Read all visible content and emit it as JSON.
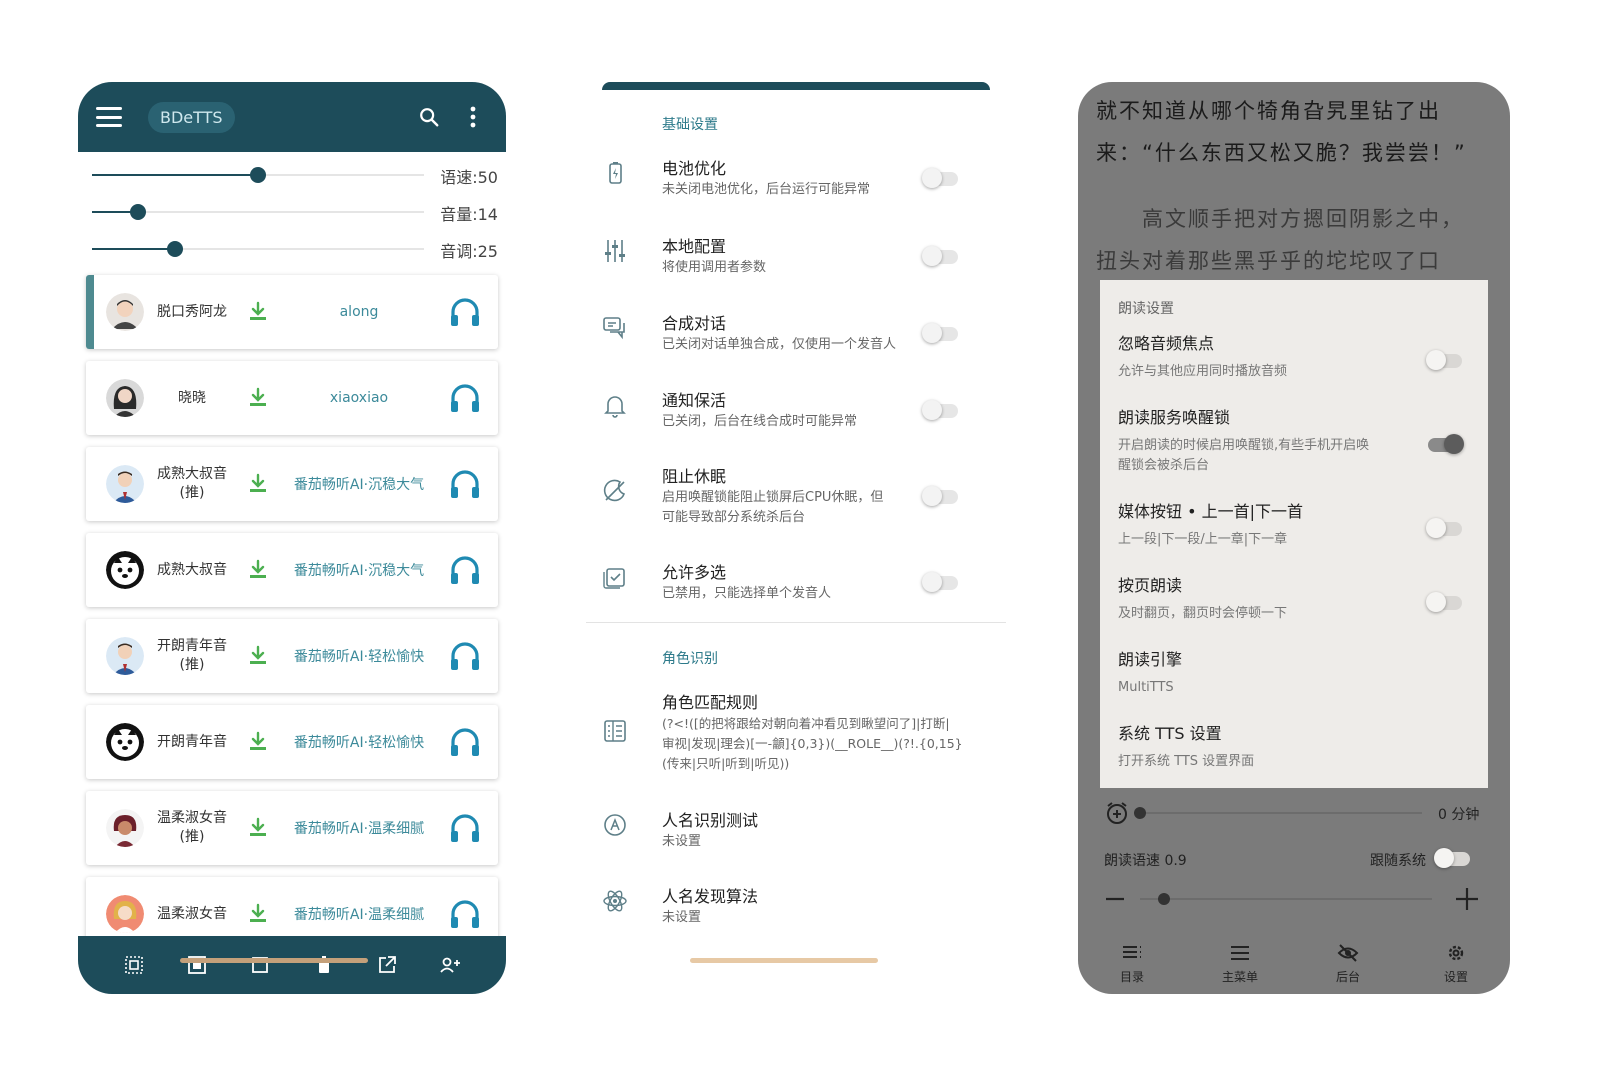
{
  "phone1": {
    "title": "BDeTTS",
    "sliders": [
      {
        "label": "语速:50",
        "value": 50
      },
      {
        "label": "音量:14",
        "value": 14
      },
      {
        "label": "音调:25",
        "value": 25
      }
    ],
    "voices": [
      {
        "name": "脱口秀阿龙",
        "desc": "along"
      },
      {
        "name": "晓晓",
        "desc": "xiaoxiao"
      },
      {
        "name": "成熟大叔音\n(推)",
        "desc": "番茄畅听AI·沉稳大气"
      },
      {
        "name": "成熟大叔音",
        "desc": "番茄畅听AI·沉稳大气"
      },
      {
        "name": "开朗青年音\n(推)",
        "desc": "番茄畅听AI·轻松愉快"
      },
      {
        "name": "开朗青年音",
        "desc": "番茄畅听AI·轻松愉快"
      },
      {
        "name": "温柔淑女音\n(推)",
        "desc": "番茄畅听AI·温柔细腻"
      },
      {
        "name": "温柔淑女音",
        "desc": "番茄畅听AI·温柔细腻"
      }
    ],
    "colors": {
      "primary": "#1d4c5a",
      "accent": "#3c8a9a",
      "download": "#4caf50"
    }
  },
  "phone2": {
    "section_basic": "基础设置",
    "settings": [
      {
        "title": "电池优化",
        "sub": "未关闭电池优化，后台运行可能异常"
      },
      {
        "title": "本地配置",
        "sub": "将使用调用者参数"
      },
      {
        "title": "合成对话",
        "sub": "已关闭对话单独合成，仅使用一个发音人"
      },
      {
        "title": "通知保活",
        "sub": "已关闭，后台在线合成时可能异常"
      },
      {
        "title": "阻止休眠",
        "sub": "启用唤醒锁能阻止锁屏后CPU休眠，但\n可能导致部分系统杀后台"
      },
      {
        "title": "允许多选",
        "sub": "已禁用，只能选择单个发音人"
      }
    ],
    "section_role": "角色识别",
    "role_settings": [
      {
        "title": "角色匹配规则",
        "sub": "(?<!([的把将跟给对朝向着冲看见到瞅望问了]|打断|\n审视|发现|理会)[一-龥]{0,3})(__ROLE__)(?!.{0,15}\n(传来|只听|听到|听见))"
      },
      {
        "title": "人名识别测试",
        "sub": "未设置"
      },
      {
        "title": "人名发现算法",
        "sub": "未设置"
      }
    ]
  },
  "phone3": {
    "text_line1": "就不知道从哪个犄角旮旯里钻了出",
    "text_line2": "来：“什么东西又松又脆？我尝尝！”",
    "text_line3": "　　高文顺手把对方摁回阴影之中，",
    "text_line4": "扭头对着那些黑乎乎的坨坨叹了口",
    "panel_title": "朗读设置",
    "items": [
      {
        "title": "忽略音频焦点",
        "sub": "允许与其他应用同时播放音频"
      },
      {
        "title": "朗读服务唤醒锁",
        "sub": "开启朗读的时候启用唤醒锁,有些手机开启唤\n醒锁会被杀后台"
      },
      {
        "title": "媒体按钮 • 上一首|下一首",
        "sub": "上一段|下一段/上一章|下一章"
      },
      {
        "title": "按页朗读",
        "sub": "及时翻页，翻页时会停顿一下"
      },
      {
        "title": "朗读引擎",
        "sub": "MultiTTS"
      },
      {
        "title": "系统 TTS 设置",
        "sub": "打开系统 TTS 设置界面"
      }
    ],
    "timer_label": "0 分钟",
    "speed_label": "朗读语速 0.9",
    "follow_system": "跟随系统",
    "nav": [
      "目录",
      "主菜单",
      "后台",
      "设置"
    ]
  }
}
